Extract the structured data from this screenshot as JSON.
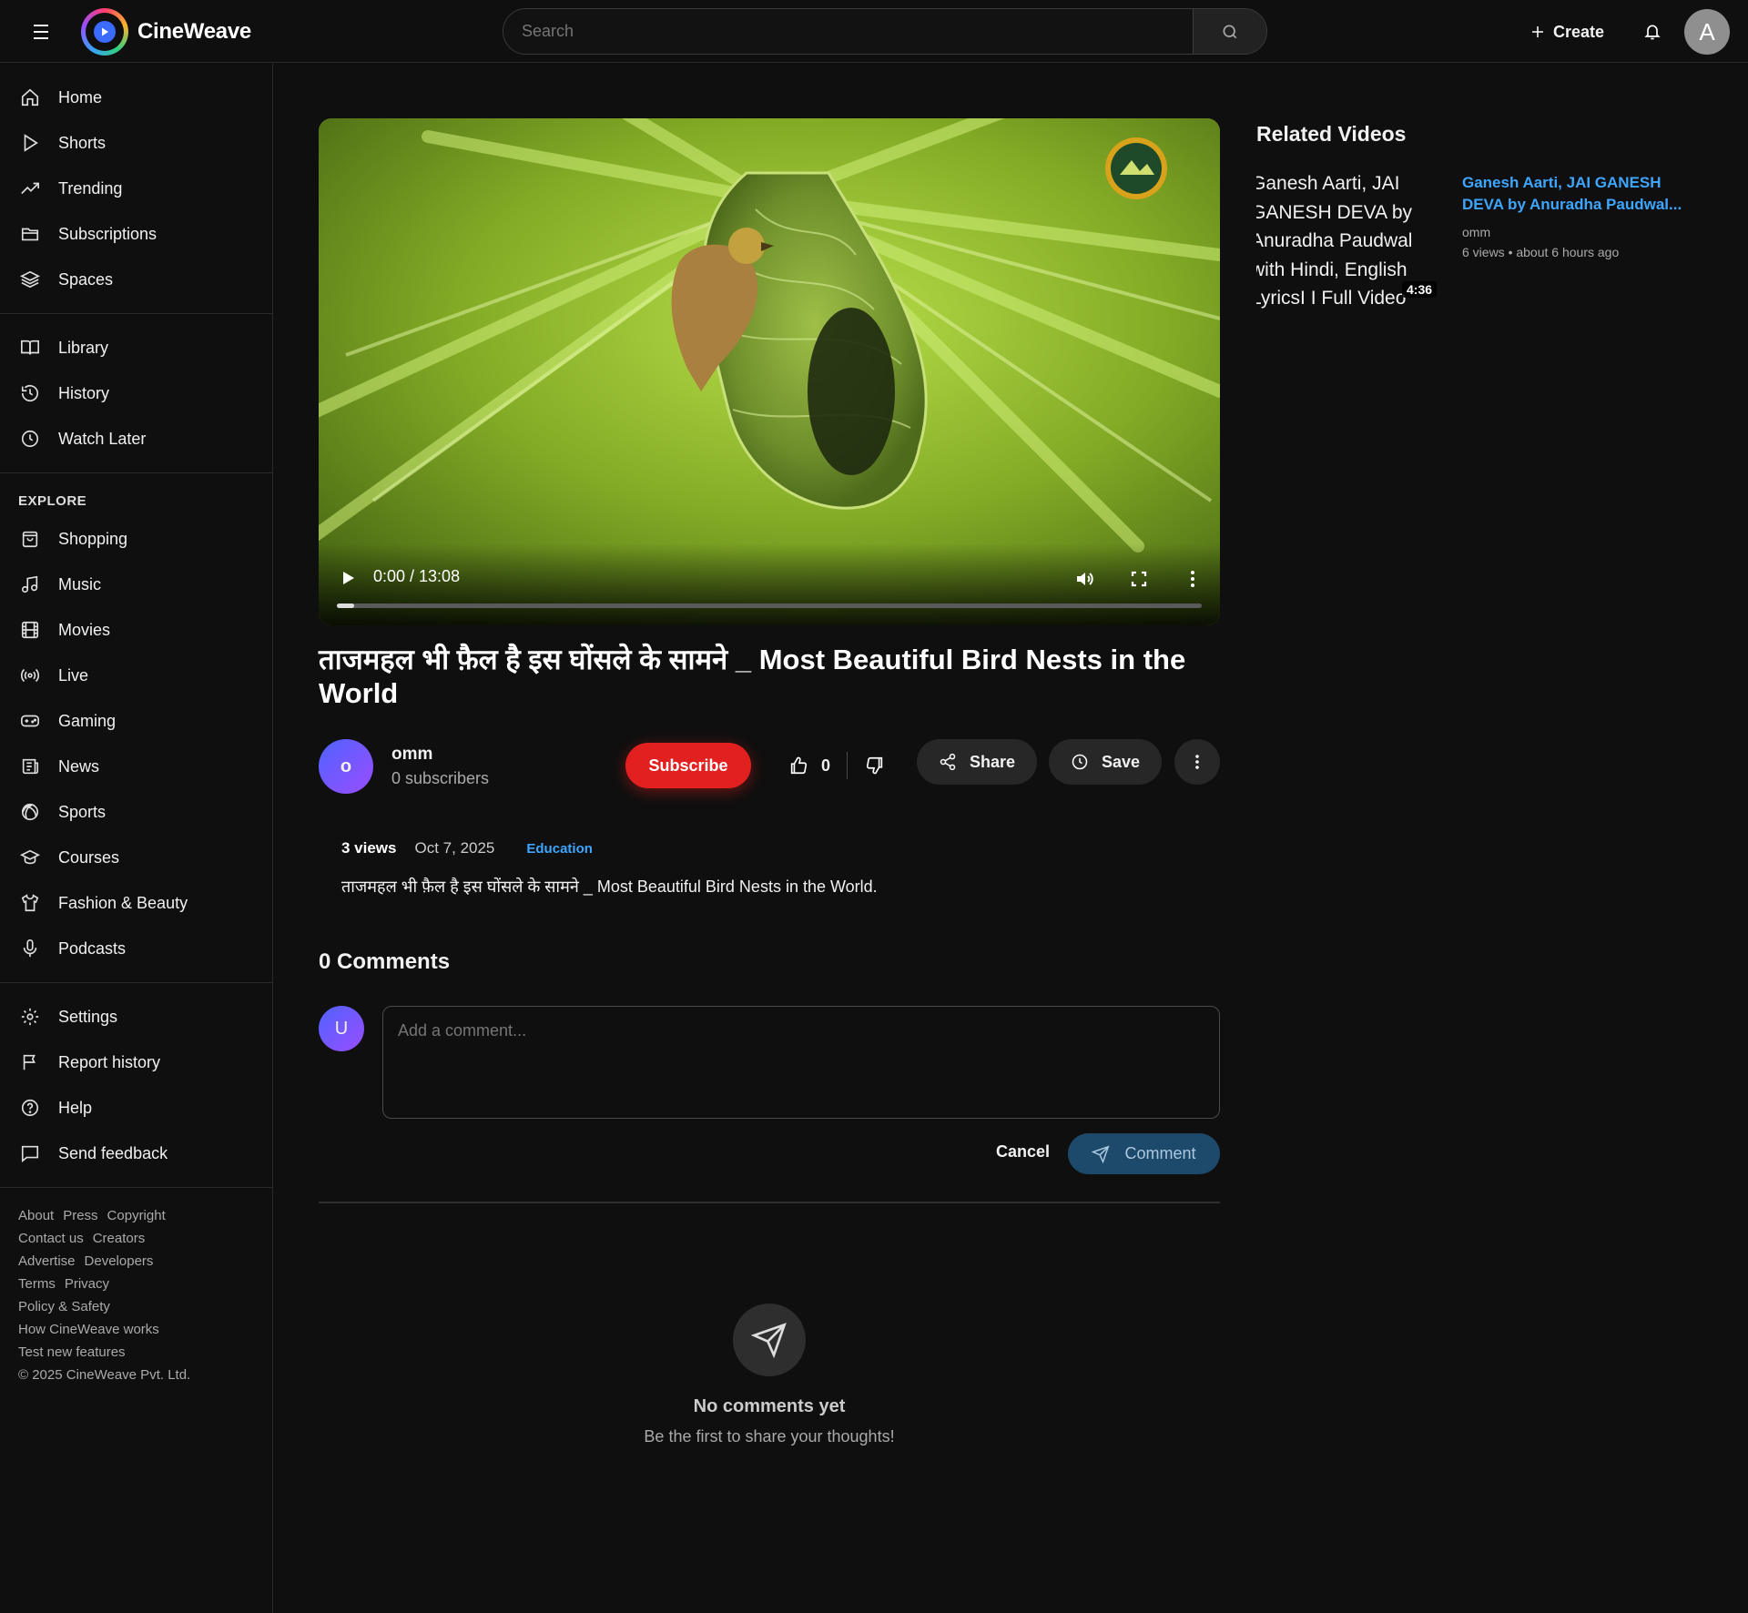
{
  "app": {
    "name": "CineWeave"
  },
  "header": {
    "search_placeholder": "Search",
    "create_label": "Create",
    "avatar_initial": "A"
  },
  "sidebar": {
    "main": [
      {
        "label": "Home",
        "icon": "home-icon"
      },
      {
        "label": "Shorts",
        "icon": "play-icon"
      },
      {
        "label": "Trending",
        "icon": "trending-icon"
      },
      {
        "label": "Subscriptions",
        "icon": "folder-icon"
      },
      {
        "label": "Spaces",
        "icon": "layers-icon"
      }
    ],
    "library": [
      {
        "label": "Library",
        "icon": "book-icon"
      },
      {
        "label": "History",
        "icon": "history-icon"
      },
      {
        "label": "Watch Later",
        "icon": "clock-icon"
      }
    ],
    "explore_heading": "EXPLORE",
    "explore": [
      {
        "label": "Shopping",
        "icon": "shopping-bag-icon"
      },
      {
        "label": "Music",
        "icon": "music-icon"
      },
      {
        "label": "Movies",
        "icon": "film-icon"
      },
      {
        "label": "Live",
        "icon": "broadcast-icon"
      },
      {
        "label": "Gaming",
        "icon": "gamepad-icon"
      },
      {
        "label": "News",
        "icon": "newspaper-icon"
      },
      {
        "label": "Sports",
        "icon": "ball-icon"
      },
      {
        "label": "Courses",
        "icon": "graduation-cap-icon"
      },
      {
        "label": "Fashion & Beauty",
        "icon": "shirt-icon"
      },
      {
        "label": "Podcasts",
        "icon": "microphone-icon"
      }
    ],
    "settings": [
      {
        "label": "Settings",
        "icon": "gear-icon"
      },
      {
        "label": "Report history",
        "icon": "flag-icon"
      },
      {
        "label": "Help",
        "icon": "help-icon"
      },
      {
        "label": "Send feedback",
        "icon": "feedback-icon"
      }
    ],
    "footer": {
      "row1": [
        "About",
        "Press",
        "Copyright"
      ],
      "row2": [
        "Contact us",
        "Creators"
      ],
      "row3": [
        "Advertise",
        "Developers"
      ],
      "row4": [
        "Terms",
        "Privacy"
      ],
      "row5": "Policy & Safety",
      "row6": "How CineWeave works",
      "row7": "Test new features",
      "copyright": "© 2025 CineWeave Pvt. Ltd."
    }
  },
  "video": {
    "time": "0:00 / 13:08",
    "progress_fraction": 0.02,
    "title": "ताजमहल भी फ़ैल है इस घोंसले के सामने _ Most Beautiful Bird Nests in the World",
    "channel": {
      "avatar_initial": "o",
      "name": "omm",
      "subscribers": "0 subscribers"
    },
    "subscribe_label": "Subscribe",
    "like_count": "0",
    "share_label": "Share",
    "save_label": "Save",
    "views": "3 views",
    "date": "Oct 7, 2025",
    "category": "Education",
    "description": "ताजमहल भी फ़ैल है इस घोंसले के सामने _ Most Beautiful Bird Nests in the World."
  },
  "comments": {
    "title": "0 Comments",
    "user_initial": "U",
    "placeholder": "Add a comment...",
    "cancel_label": "Cancel",
    "submit_label": "Comment",
    "empty_title": "No comments yet",
    "empty_subtitle": "Be the first to share your thoughts!"
  },
  "related": {
    "heading": "Related Videos",
    "items": [
      {
        "thumb_alt": "Ganesh Aarti, JAI GANESH DEVA by Anuradha Paudwal with Hindi, English LyricsI I Full Video Song",
        "duration": "4:36",
        "title": "Ganesh Aarti, JAI GANESH DEVA by Anuradha Paudwal...",
        "channel": "omm",
        "meta": "6 views • about 6 hours ago"
      }
    ]
  },
  "colors": {
    "background": "#0f0f0f",
    "accent_red": "#e32020",
    "link_blue": "#3ea6ff",
    "avatar_gradient_start": "#4f63ff",
    "avatar_gradient_end": "#9a4dff"
  }
}
